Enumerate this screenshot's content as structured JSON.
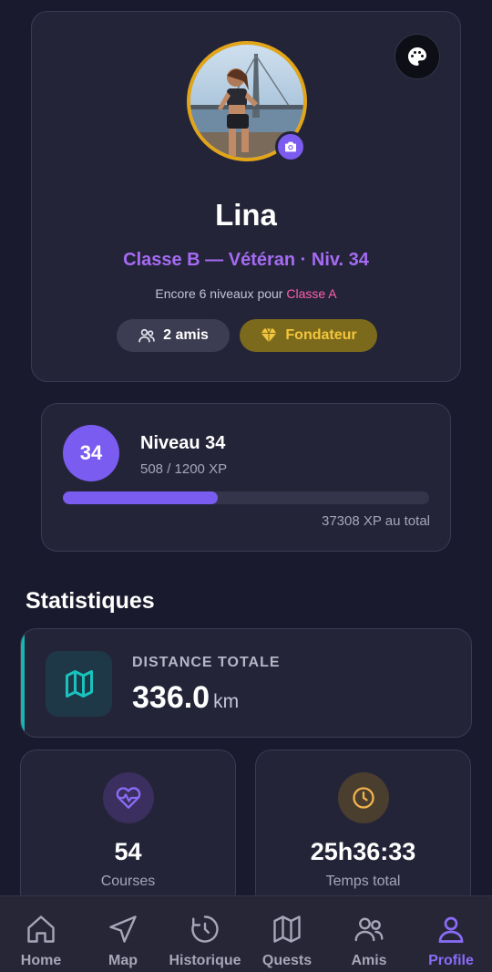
{
  "profile": {
    "name": "Lina",
    "class_line": "Classe B — Vétéran · Niv. 34",
    "promo_prefix": "Encore 6 niveaux pour ",
    "promo_target": "Classe A",
    "friends_badge": "2 amis",
    "founder_badge": "Fondateur"
  },
  "level": {
    "number": "34",
    "title": "Niveau 34",
    "xp_text": "508 / 1200 XP",
    "xp_current": 508,
    "xp_max": 1200,
    "total_text": "37308 XP au total"
  },
  "stats": {
    "section_title": "Statistiques",
    "distance_label": "DISTANCE TOTALE",
    "distance_value": "336.0",
    "distance_unit": "km",
    "courses_value": "54",
    "courses_label": "Courses",
    "time_value": "25h36:33",
    "time_label": "Temps total"
  },
  "nav": {
    "items": [
      {
        "label": "Home",
        "icon": "home-icon"
      },
      {
        "label": "Map",
        "icon": "navigation-icon"
      },
      {
        "label": "Historique",
        "icon": "history-icon"
      },
      {
        "label": "Quests",
        "icon": "map-icon"
      },
      {
        "label": "Amis",
        "icon": "users-icon"
      },
      {
        "label": "Profile",
        "icon": "user-icon",
        "active": true
      }
    ]
  },
  "colors": {
    "accent": "#7a5cf0",
    "class_text": "#a56bf2",
    "promo_target": "#ff5fa8",
    "founder_gold": "#f2c53d",
    "distance_accent": "#19b5b0"
  }
}
